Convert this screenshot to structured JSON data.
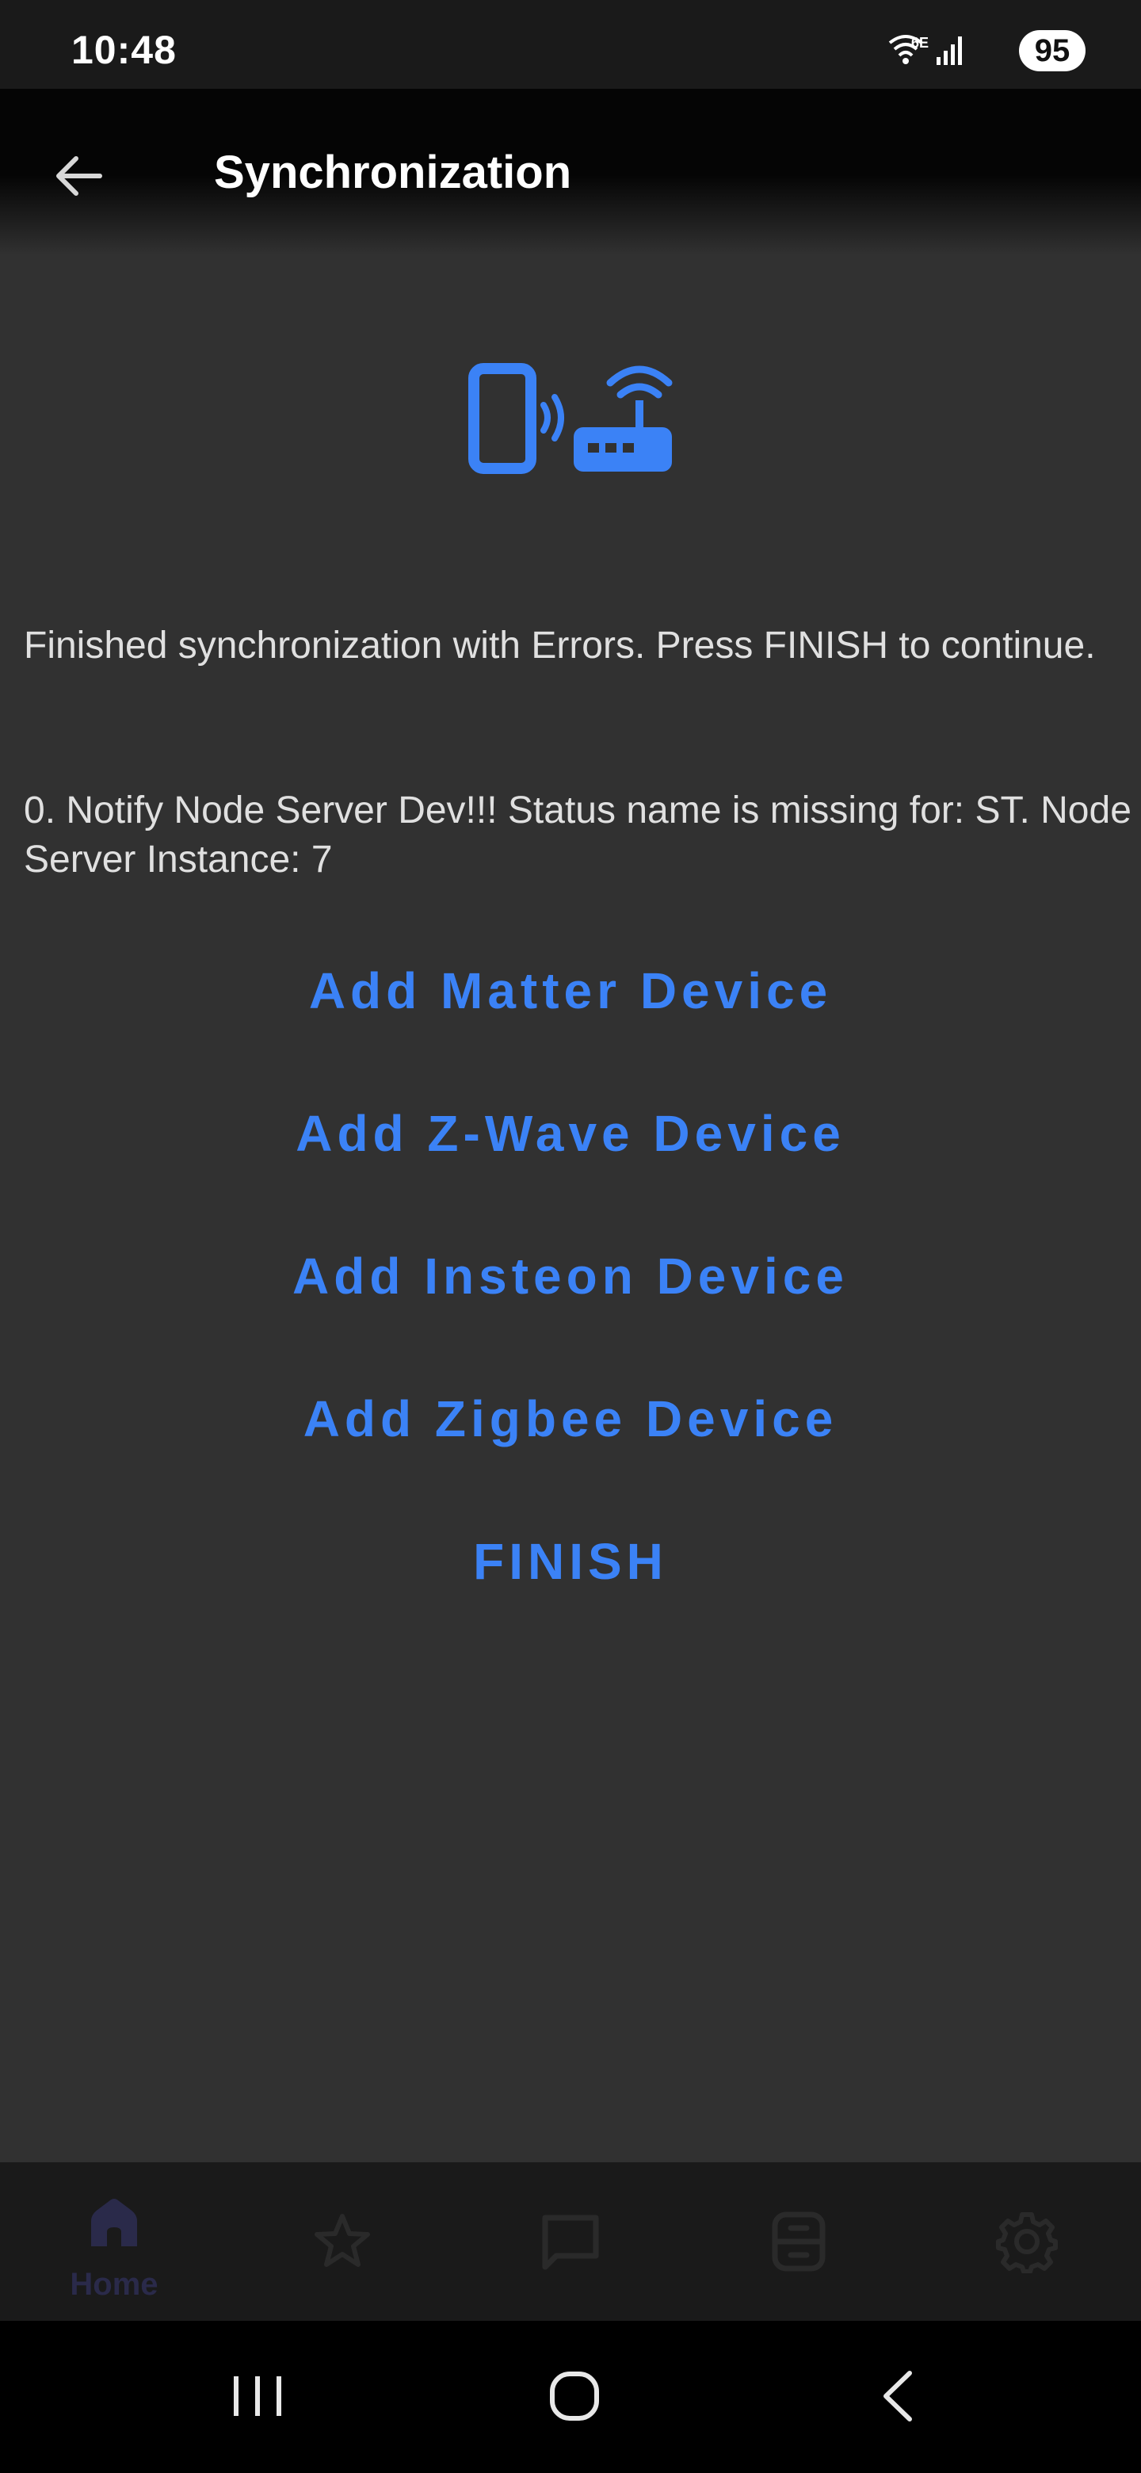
{
  "status_bar": {
    "time": "10:48",
    "wifi_label": "6E",
    "battery": "95",
    "icons": [
      "wifi-icon",
      "signal-icon",
      "battery-icon"
    ]
  },
  "app_bar": {
    "title": "Synchronization",
    "back_icon": "back-arrow-icon"
  },
  "illustration": {
    "icons": [
      "phone-icon",
      "router-icon"
    ],
    "color": "#3b82f6"
  },
  "messages": {
    "status": "Finished synchronization with Errors. Press FINISH to continue.",
    "error": "0. Notify Node Server Dev!!! Status name is missing for: ST. Node Server Instance: 7"
  },
  "actions": {
    "add_matter": "Add Matter Device",
    "add_zwave": "Add Z-Wave Device",
    "add_insteon": "Add Insteon Device",
    "add_zigbee": "Add Zigbee Device",
    "finish": "FINISH"
  },
  "bottom_nav": {
    "items": [
      {
        "icon": "home-icon",
        "label": "Home",
        "active": true
      },
      {
        "icon": "star-icon",
        "label": ""
      },
      {
        "icon": "chat-icon",
        "label": ""
      },
      {
        "icon": "device-icon",
        "label": ""
      },
      {
        "icon": "gear-icon",
        "label": ""
      }
    ]
  },
  "system_nav": {
    "icons": [
      "recent-apps-icon",
      "home-button-icon",
      "back-icon"
    ]
  },
  "colors": {
    "background": "#313131",
    "accent": "#3b82f6",
    "text": "#e0e0e0",
    "nav_background": "#1a1a1a"
  }
}
